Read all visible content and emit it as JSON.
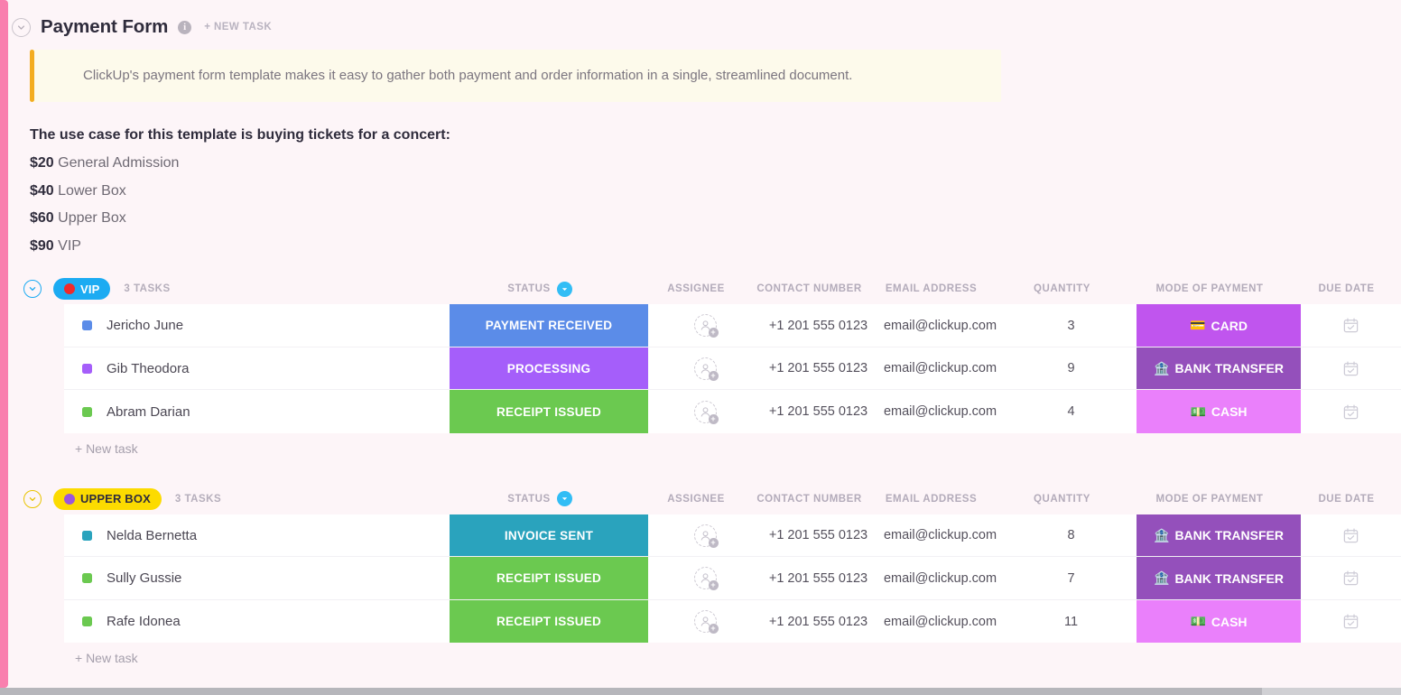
{
  "theme": {
    "page_bg": "#fdf5f8",
    "accent_pink": "#f97fae",
    "callout_bg": "#fdfaeb",
    "callout_bar": "#f3ac20"
  },
  "header": {
    "collapse_icon": "chevron-down-icon",
    "title": "Payment Form",
    "info_icon": "i",
    "new_task_label": "+ NEW TASK"
  },
  "callout": {
    "text": "ClickUp's payment form template makes it easy to gather both payment and order information in a single, streamlined document."
  },
  "usecase": {
    "title": "The use case for this template is buying tickets for a concert:",
    "prices": [
      {
        "amount": "$20",
        "label": "General Admission"
      },
      {
        "amount": "$40",
        "label": "Lower Box"
      },
      {
        "amount": "$60",
        "label": "Upper Box"
      },
      {
        "amount": "$90",
        "label": "VIP"
      }
    ]
  },
  "columns": [
    {
      "key": "status",
      "label": "STATUS",
      "has_caret": true
    },
    {
      "key": "assignee",
      "label": "ASSIGNEE",
      "has_caret": false
    },
    {
      "key": "contact",
      "label": "CONTACT NUMBER",
      "has_caret": false
    },
    {
      "key": "email",
      "label": "EMAIL ADDRESS",
      "has_caret": false
    },
    {
      "key": "quantity",
      "label": "QUANTITY",
      "has_caret": false
    },
    {
      "key": "mode",
      "label": "MODE OF PAYMENT",
      "has_caret": false
    },
    {
      "key": "due",
      "label": "DUE DATE",
      "has_caret": false
    }
  ],
  "new_task_label": "+ New task",
  "groups": [
    {
      "name": "VIP",
      "badge_bg": "#1cabf2",
      "badge_text_color": "#ffffff",
      "badge_dot_color": "#f02a2a",
      "chevron_color": "#1cabf2",
      "count_label": "3 TASKS",
      "status_underline": "#5b8ce8",
      "mode_underline": "#b35bf0",
      "tasks": [
        {
          "name": "Jericho June",
          "dot_color": "#5b8ce8",
          "status": "PAYMENT RECEIVED",
          "status_color": "#5b8ce8",
          "assignee": "",
          "contact": "+1 201 555 0123",
          "email": "email@clickup.com",
          "quantity": "3",
          "mode": "CARD",
          "mode_icon": "💳",
          "mode_color": "#c055ee"
        },
        {
          "name": "Gib Theodora",
          "dot_color": "#a55efa",
          "status": "PROCESSING",
          "status_color": "#a55efa",
          "assignee": "",
          "contact": "+1 201 555 0123",
          "email": "email@clickup.com",
          "quantity": "9",
          "mode": "BANK TRANSFER",
          "mode_icon": "🏦",
          "mode_color": "#9450bb"
        },
        {
          "name": "Abram Darian",
          "dot_color": "#6bc950",
          "status": "RECEIPT ISSUED",
          "status_color": "#6bc950",
          "assignee": "",
          "contact": "+1 201 555 0123",
          "email": "email@clickup.com",
          "quantity": "4",
          "mode": "CASH",
          "mode_icon": "💵",
          "mode_color": "#ea80fb"
        }
      ]
    },
    {
      "name": "UPPER BOX",
      "badge_bg": "#fcdb00",
      "badge_text_color": "#2f2c3c",
      "badge_dot_color": "#9a56dd",
      "chevron_color": "#e8c400",
      "count_label": "3 TASKS",
      "status_underline": "#2aa3bd",
      "mode_underline": "#9450bb",
      "tasks": [
        {
          "name": "Nelda Bernetta",
          "dot_color": "#2aa3bd",
          "status": "INVOICE SENT",
          "status_color": "#2aa3bd",
          "assignee": "",
          "contact": "+1 201 555 0123",
          "email": "email@clickup.com",
          "quantity": "8",
          "mode": "BANK TRANSFER",
          "mode_icon": "🏦",
          "mode_color": "#9450bb"
        },
        {
          "name": "Sully Gussie",
          "dot_color": "#6bc950",
          "status": "RECEIPT ISSUED",
          "status_color": "#6bc950",
          "assignee": "",
          "contact": "+1 201 555 0123",
          "email": "email@clickup.com",
          "quantity": "7",
          "mode": "BANK TRANSFER",
          "mode_icon": "🏦",
          "mode_color": "#9450bb"
        },
        {
          "name": "Rafe Idonea",
          "dot_color": "#6bc950",
          "status": "RECEIPT ISSUED",
          "status_color": "#6bc950",
          "assignee": "",
          "contact": "+1 201 555 0123",
          "email": "email@clickup.com",
          "quantity": "11",
          "mode": "CASH",
          "mode_icon": "💵",
          "mode_color": "#ea80fb"
        }
      ]
    }
  ]
}
